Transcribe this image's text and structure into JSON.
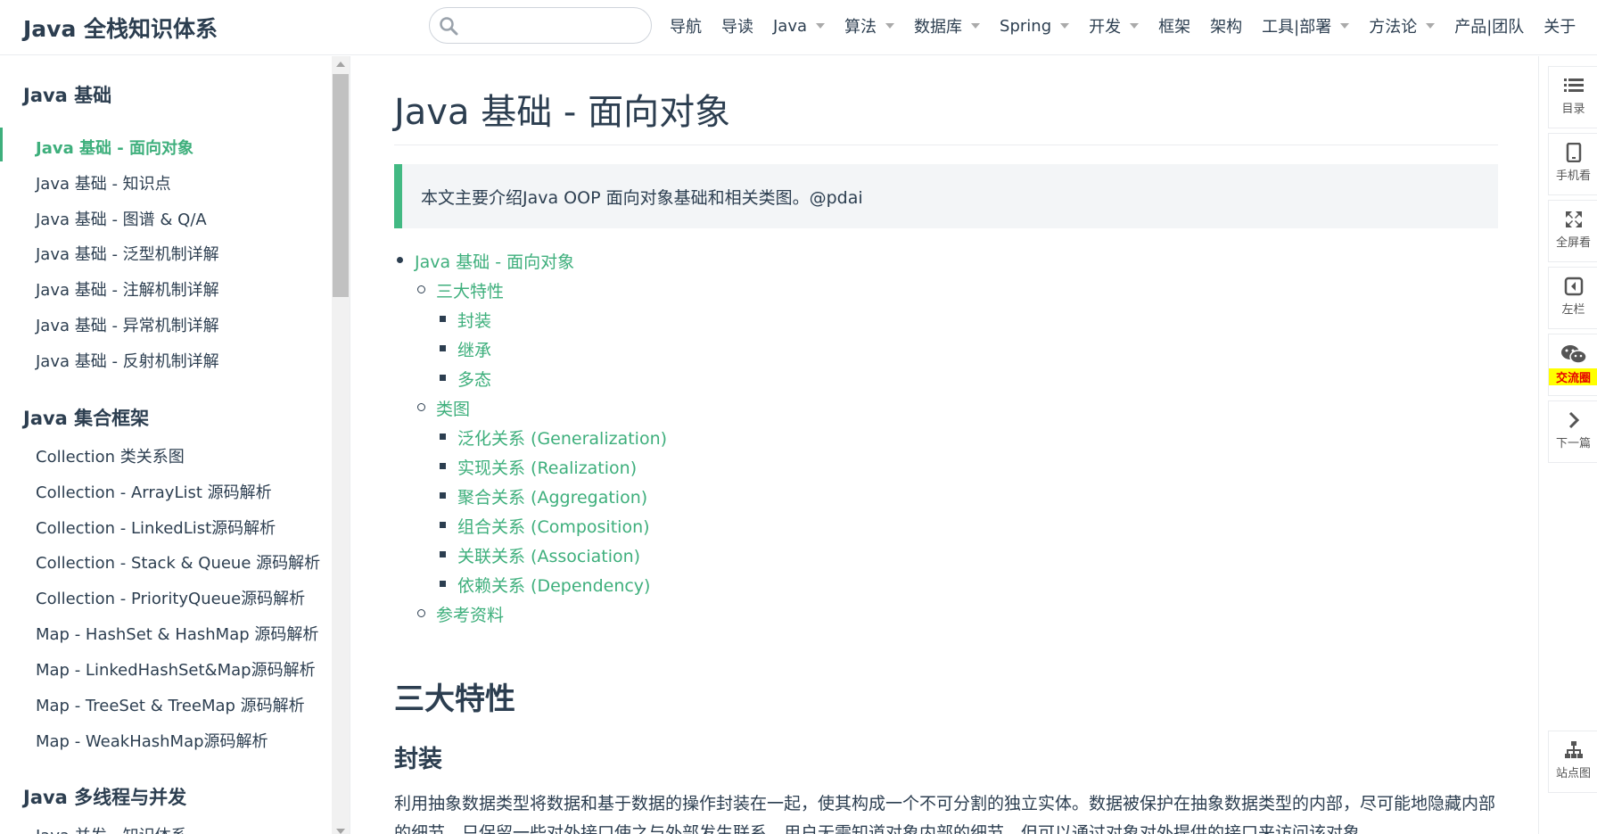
{
  "navbar": {
    "site_title": "Java 全栈知识体系",
    "search": {
      "value": "",
      "placeholder": ""
    },
    "items": [
      {
        "label": "导航",
        "dropdown": false
      },
      {
        "label": "导读",
        "dropdown": false
      },
      {
        "label": "Java",
        "dropdown": true
      },
      {
        "label": "算法",
        "dropdown": true
      },
      {
        "label": "数据库",
        "dropdown": true
      },
      {
        "label": "Spring",
        "dropdown": true
      },
      {
        "label": "开发",
        "dropdown": true
      },
      {
        "label": "框架",
        "dropdown": false
      },
      {
        "label": "架构",
        "dropdown": false
      },
      {
        "label": "工具|部署",
        "dropdown": true
      },
      {
        "label": "方法论",
        "dropdown": true
      },
      {
        "label": "产品|团队",
        "dropdown": false
      },
      {
        "label": "关于",
        "dropdown": false
      }
    ]
  },
  "sidebar": {
    "groups": [
      {
        "title": "Java 基础",
        "links": [
          {
            "label": "Java 基础 - 面向对象",
            "active": true
          },
          {
            "label": "Java 基础 - 知识点",
            "active": false
          },
          {
            "label": "Java 基础 - 图谱 & Q/A",
            "active": false
          },
          {
            "label": "Java 基础 - 泛型机制详解",
            "active": false
          },
          {
            "label": "Java 基础 - 注解机制详解",
            "active": false
          },
          {
            "label": "Java 基础 - 异常机制详解",
            "active": false
          },
          {
            "label": "Java 基础 - 反射机制详解",
            "active": false
          }
        ]
      },
      {
        "title": "Java 集合框架",
        "links": [
          {
            "label": "Collection 类关系图",
            "active": false
          },
          {
            "label": "Collection - ArrayList 源码解析",
            "active": false
          },
          {
            "label": "Collection - LinkedList源码解析",
            "active": false
          },
          {
            "label": "Collection - Stack & Queue 源码解析",
            "active": false
          },
          {
            "label": "Collection - PriorityQueue源码解析",
            "active": false
          },
          {
            "label": "Map - HashSet & HashMap 源码解析",
            "active": false
          },
          {
            "label": "Map - LinkedHashSet&Map源码解析",
            "active": false
          },
          {
            "label": "Map - TreeSet & TreeMap 源码解析",
            "active": false
          },
          {
            "label": "Map - WeakHashMap源码解析",
            "active": false
          }
        ]
      },
      {
        "title": "Java 多线程与并发",
        "links": [
          {
            "label": "Java 并发 - 知识体系",
            "active": false
          }
        ]
      }
    ]
  },
  "content": {
    "title": "Java 基础 - 面向对象",
    "intro": "本文主要介绍Java OOP 面向对象基础和相关类图。@pdai",
    "toc": [
      {
        "label": "Java 基础 - 面向对象",
        "level": 1
      },
      {
        "label": "三大特性",
        "level": 2
      },
      {
        "label": "封装",
        "level": 3
      },
      {
        "label": "继承",
        "level": 3
      },
      {
        "label": "多态",
        "level": 3
      },
      {
        "label": "类图",
        "level": 2
      },
      {
        "label": "泛化关系 (Generalization)",
        "level": 3
      },
      {
        "label": "实现关系 (Realization)",
        "level": 3
      },
      {
        "label": "聚合关系 (Aggregation)",
        "level": 3
      },
      {
        "label": "组合关系 (Composition)",
        "level": 3
      },
      {
        "label": "关联关系 (Association)",
        "level": 3
      },
      {
        "label": "依赖关系 (Dependency)",
        "level": 3
      },
      {
        "label": "参考资料",
        "level": 2
      }
    ],
    "h2": "三大特性",
    "h3": "封装",
    "paragraph": "利用抽象数据类型将数据和基于数据的操作封装在一起，使其构成一个不可分割的独立实体。数据被保护在抽象数据类型的内部，尽可能地隐藏内部的细节，只保留一些对外接口使之与外部发生联系。用户无需知道对象内部的细节，但可以通过对象对外提供的接口来访问该对象。"
  },
  "toolbar": {
    "items": [
      {
        "label": "目录",
        "icon": "list-icon",
        "highlight": false
      },
      {
        "label": "手机看",
        "icon": "mobile-icon",
        "highlight": false
      },
      {
        "label": "全屏看",
        "icon": "fullscreen-icon",
        "highlight": false
      },
      {
        "label": "左栏",
        "icon": "left-panel-icon",
        "highlight": false
      },
      {
        "label": "交流圈",
        "icon": "wechat-icon",
        "highlight": true
      },
      {
        "label": "下一篇",
        "icon": "chevron-right-icon",
        "highlight": false
      }
    ],
    "sitemap_label": "站点图",
    "sitemap_icon": "sitemap-icon"
  },
  "colors": {
    "accent": "#3eaf7c",
    "text": "#2c3e50",
    "quote_bg": "#f3f5f7",
    "quote_border": "#42b983",
    "highlight_bg": "#ffff00",
    "highlight_text": "#e60000"
  }
}
